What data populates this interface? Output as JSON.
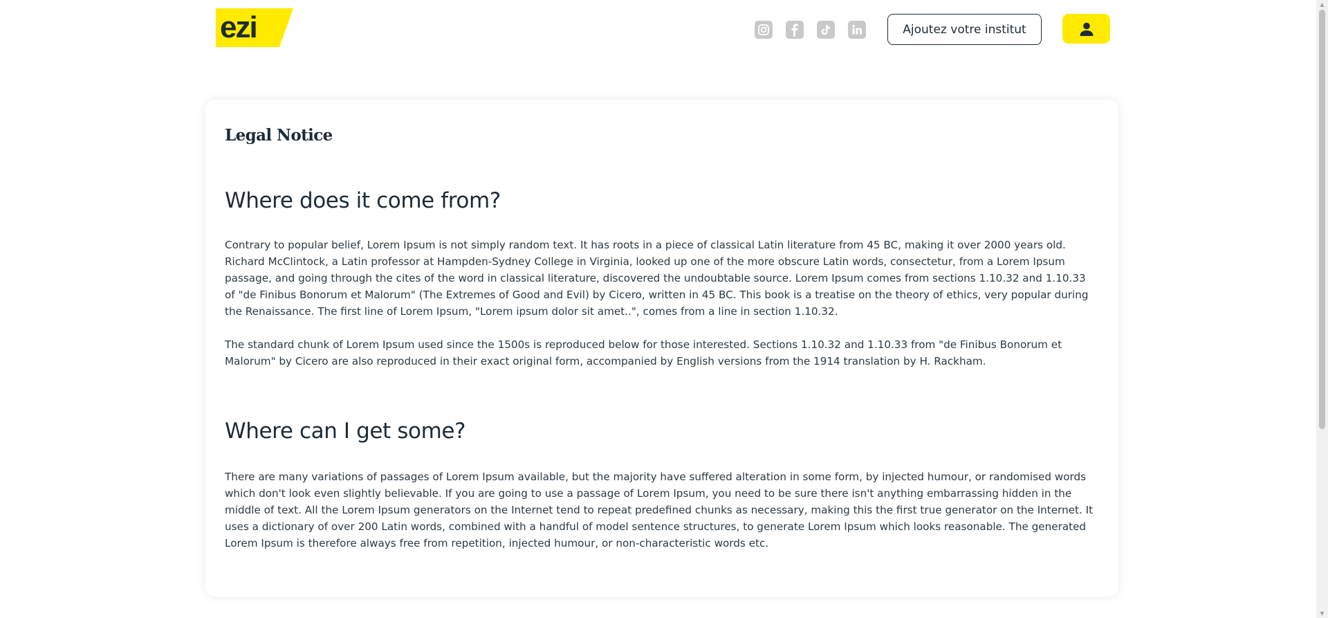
{
  "header": {
    "logo_text": "ezi",
    "socials": [
      {
        "name": "instagram-icon"
      },
      {
        "name": "facebook-icon"
      },
      {
        "name": "tiktok-icon"
      },
      {
        "name": "linkedin-icon"
      }
    ],
    "cta_label": "Ajoutez votre institut",
    "account_icon": "user-icon"
  },
  "colors": {
    "brand_yellow": "#ffea00",
    "text_dark": "#1d2b36",
    "icon_gray": "#c9c9c9"
  },
  "content": {
    "title": "Legal Notice",
    "sections": [
      {
        "heading": "Where does it come from?",
        "paragraphs": [
          "Contrary to popular belief, Lorem Ipsum is not simply random text. It has roots in a piece of classical Latin literature from 45 BC, making it over 2000 years old. Richard McClintock, a Latin professor at Hampden-Sydney College in Virginia, looked up one of the more obscure Latin words, consectetur, from a Lorem Ipsum passage, and going through the cites of the word in classical literature, discovered the undoubtable source. Lorem Ipsum comes from sections 1.10.32 and 1.10.33 of \"de Finibus Bonorum et Malorum\" (The Extremes of Good and Evil) by Cicero, written in 45 BC. This book is a treatise on the theory of ethics, very popular during the Renaissance. The first line of Lorem Ipsum, \"Lorem ipsum dolor sit amet..\", comes from a line in section 1.10.32.",
          "The standard chunk of Lorem Ipsum used since the 1500s is reproduced below for those interested. Sections 1.10.32 and 1.10.33 from \"de Finibus Bonorum et Malorum\" by Cicero are also reproduced in their exact original form, accompanied by English versions from the 1914 translation by H. Rackham."
        ]
      },
      {
        "heading": "Where can I get some?",
        "paragraphs": [
          "There are many variations of passages of Lorem Ipsum available, but the majority have suffered alteration in some form, by injected humour, or randomised words which don't look even slightly believable. If you are going to use a passage of Lorem Ipsum, you need to be sure there isn't anything embarrassing hidden in the middle of text. All the Lorem Ipsum generators on the Internet tend to repeat predefined chunks as necessary, making this the first true generator on the Internet. It uses a dictionary of over 200 Latin words, combined with a handful of model sentence structures, to generate Lorem Ipsum which looks reasonable. The generated Lorem Ipsum is therefore always free from repetition, injected humour, or non-characteristic words etc."
        ]
      }
    ]
  }
}
